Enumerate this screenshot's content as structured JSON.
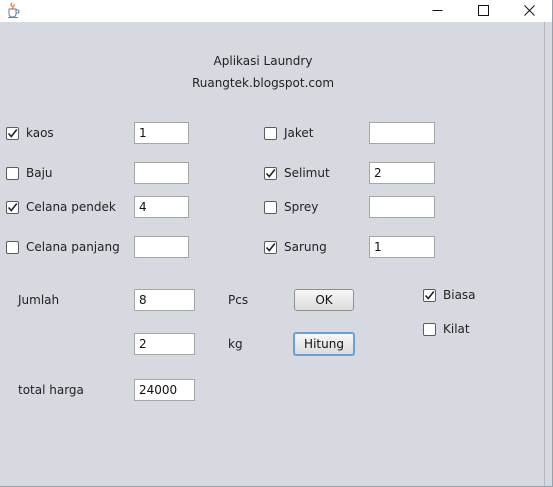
{
  "window": {
    "icon": "java-cup-icon",
    "controls": {
      "minimize": "─",
      "maximize": "☐",
      "close": "✕"
    }
  },
  "header": {
    "title": "Aplikasi Laundry",
    "subtitle": "Ruangtek.blogspot.com"
  },
  "items": [
    {
      "label": "kaos",
      "checked": true,
      "value": "1"
    },
    {
      "label": "Baju",
      "checked": false,
      "value": ""
    },
    {
      "label": "Celana pendek",
      "checked": true,
      "value": "4"
    },
    {
      "label": "Celana panjang",
      "checked": false,
      "value": ""
    },
    {
      "label": "Jaket",
      "checked": false,
      "value": ""
    },
    {
      "label": "Selimut",
      "checked": true,
      "value": "2"
    },
    {
      "label": "Sprey",
      "checked": false,
      "value": ""
    },
    {
      "label": "Sarung",
      "checked": true,
      "value": "1"
    }
  ],
  "jumlah": {
    "label": "Jumlah",
    "pcs_value": "8",
    "pcs_unit": "Pcs",
    "kg_value": "2",
    "kg_unit": "kg"
  },
  "buttons": {
    "ok": "OK",
    "hitung": "Hitung"
  },
  "service": [
    {
      "label": "Biasa",
      "checked": true
    },
    {
      "label": "Kilat",
      "checked": false
    }
  ],
  "total": {
    "label": "total harga",
    "value": "24000"
  }
}
